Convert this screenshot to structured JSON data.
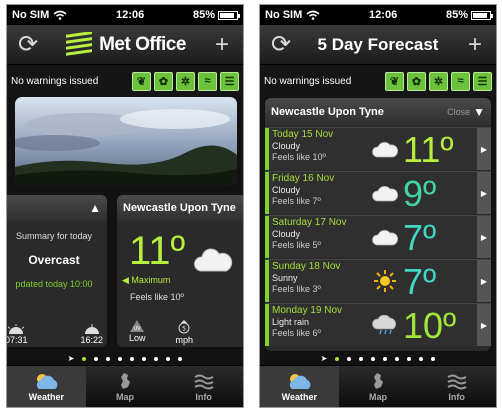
{
  "status": {
    "carrier": "No SIM",
    "time": "12:06",
    "battery": "85%",
    "battery_level": 0.85
  },
  "left": {
    "logo_text": "Met Office",
    "warnings": "No warnings issued",
    "warning_icons": [
      "leaf-icon",
      "pollen-icon",
      "snowflake-icon",
      "flood-icon",
      "list-icon"
    ],
    "summary": {
      "for_label": "Summary for today",
      "value": "Overcast",
      "updated": "pdated today 10:00",
      "sunrise": "07:31",
      "sunset": "16:22"
    },
    "now": {
      "location": "Newcastle Upon Tyne",
      "temp": "11º",
      "max_label": "Maximum",
      "feels": "Feels like 10º",
      "uv_label": "Low",
      "uv_icon_label": "UV",
      "wind_speed": "5",
      "wind_unit": "mph",
      "edge_text": "U"
    }
  },
  "right": {
    "title": "5 Day Forecast",
    "warnings": "No warnings issued",
    "location": "Newcastle Upon Tyne",
    "close_label": "Close",
    "days": [
      {
        "day": "Today 15 Nov",
        "desc": "Cloudy",
        "feels": "Feels like 10º",
        "temp": "11º",
        "icon": "cloud-icon",
        "color": "#b7ef3e"
      },
      {
        "day": "Friday 16 Nov",
        "desc": "Cloudy",
        "feels": "Feels like 7º",
        "temp": "9º",
        "icon": "cloud-icon",
        "color": "#3fd6a0"
      },
      {
        "day": "Saturday 17 Nov",
        "desc": "Cloudy",
        "feels": "Feels like 5º",
        "temp": "7º",
        "icon": "cloud-icon",
        "color": "#3fd6c4"
      },
      {
        "day": "Sunday 18 Nov",
        "desc": "Sunny",
        "feels": "Feels like 3º",
        "temp": "7º",
        "icon": "sun-icon",
        "color": "#3fd6c4"
      },
      {
        "day": "Monday 19 Nov",
        "desc": "Light rain",
        "feels": "Feels like 6º",
        "temp": "10º",
        "icon": "rain-cloud-icon",
        "color": "#9fe83a"
      }
    ]
  },
  "tabs": [
    {
      "label": "Weather",
      "active": true
    },
    {
      "label": "Map",
      "active": false
    },
    {
      "label": "Info",
      "active": false
    }
  ],
  "pages": {
    "count": 10,
    "active": 1
  }
}
